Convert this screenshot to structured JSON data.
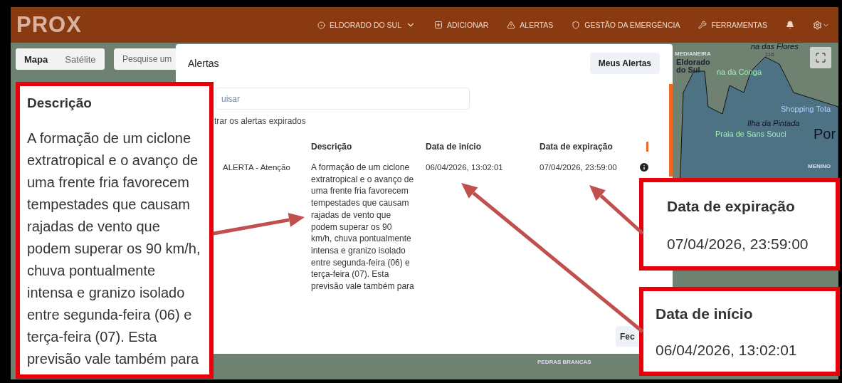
{
  "header": {
    "logo": "PROX",
    "nav": [
      {
        "kind": "location",
        "label": "ELDORADO DO SUL"
      },
      {
        "kind": "add",
        "label": "ADICIONAR"
      },
      {
        "kind": "alert",
        "label": "ALERTAS"
      },
      {
        "kind": "shield",
        "label": "GESTÃO DA EMERGÊNCIA"
      },
      {
        "kind": "tools",
        "label": "FERRAMENTAS"
      }
    ]
  },
  "map": {
    "tabs": [
      {
        "label": "Mapa",
        "selected": true
      },
      {
        "label": "Satélite",
        "selected": false
      }
    ],
    "search": {
      "placeholder": "Pesquise um"
    },
    "labels": [
      {
        "kind": "district",
        "text": "MEDIANEIRA"
      },
      {
        "kind": "city",
        "text": "Eldorado do Sul"
      },
      {
        "kind": "place",
        "text": "na da Conga"
      },
      {
        "kind": "island",
        "text": "Ilha da Pintada"
      },
      {
        "kind": "place",
        "text": "Praia de Sans Souci"
      },
      {
        "kind": "shop",
        "text": "Shopping Tota"
      },
      {
        "kind": "big",
        "text": "Por"
      },
      {
        "kind": "district",
        "text": "MENINO"
      },
      {
        "kind": "district",
        "text": "PEDRAS BRANCAS"
      },
      {
        "kind": "island",
        "text": "na das Flores"
      },
      {
        "kind": "road",
        "text": "116"
      }
    ]
  },
  "modal": {
    "title": "Alertas",
    "button": "Meus Alertas",
    "search": {
      "placeholder": "uisar"
    },
    "filter": "trar os alertas expirados",
    "columns": [
      "Descrição",
      "Data de início",
      "Data de expiração"
    ],
    "rows": [
      {
        "type": "ALERTA - Atenção",
        "description": "A formação de um ciclone extratropical e o avanço de uma frente fria favorecem tempestades que causam rajadas de vento que podem superar os 90 km/h, chuva pontualmente intensa e granizo isolado entre segunda-feira (06) e terça-feira (07). Esta previsão vale também para",
        "start": "06/04/2026, 13:02:01",
        "end": "07/04/2026, 23:59:00"
      }
    ],
    "close": "Fec"
  },
  "callouts": [
    {
      "kind": "tall",
      "title": "Descrição",
      "text": "A formação de um ciclone extratropical e o avanço de uma frente fria favorecem tempestades que causam rajadas de vento que podem superar os 90 km/h, chuva pontualmente intensa e granizo isolado entre segunda-feira (06) e terça-feira (07). Esta previsão vale também para"
    },
    {
      "kind": "top",
      "title": "Data de expiração",
      "text": "07/04/2026, 23:59:00"
    },
    {
      "kind": "bottom",
      "title": "Data de início",
      "text": "06/04/2026, 13:02:01"
    }
  ]
}
